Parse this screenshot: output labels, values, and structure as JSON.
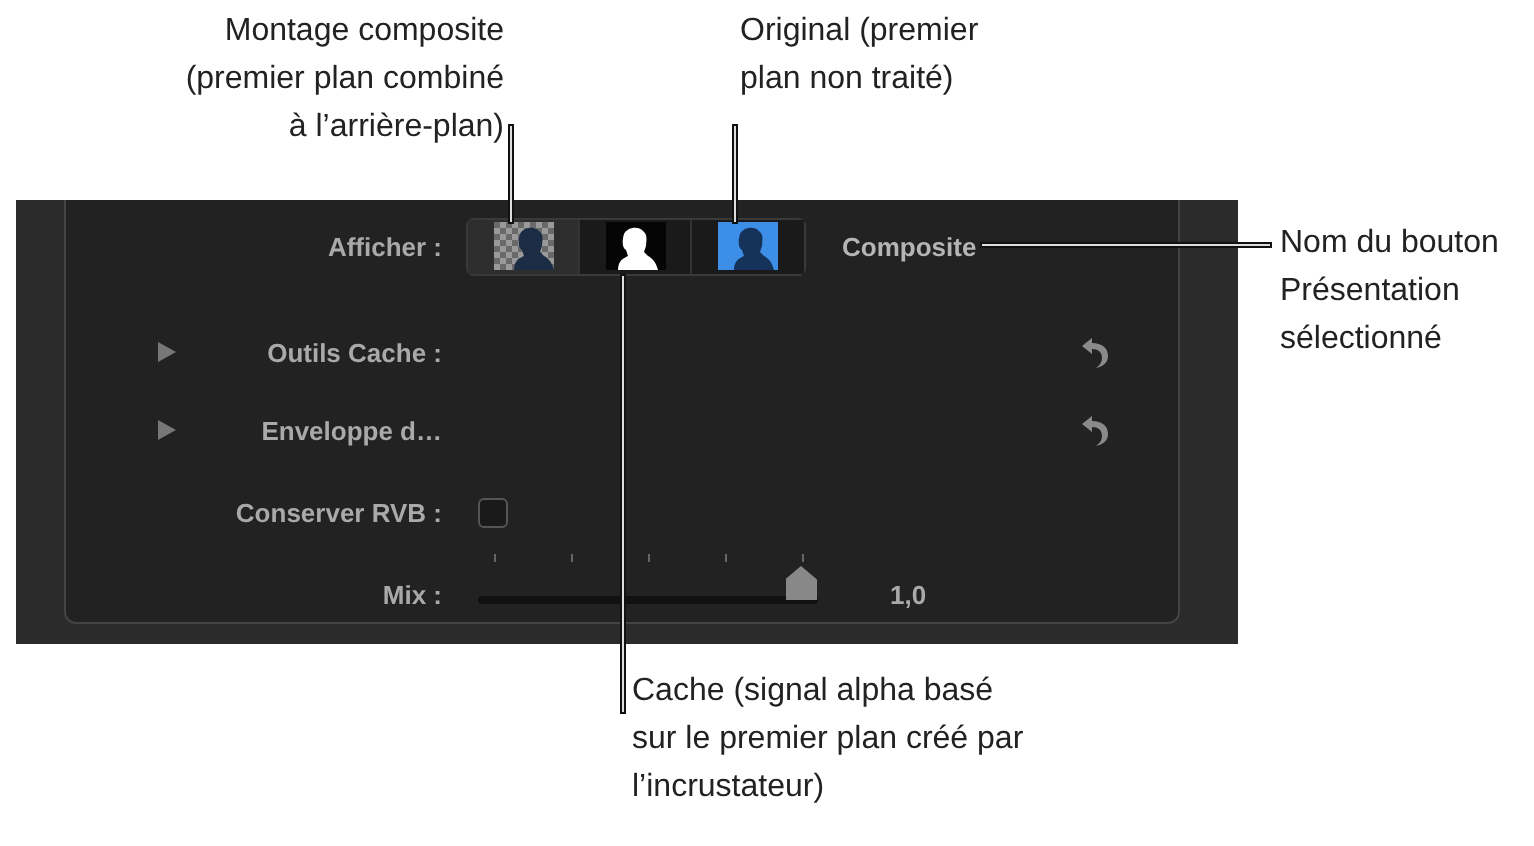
{
  "callouts": [
    {
      "lines": [
        "Montage composite",
        "(premier plan combiné",
        "à l’arrière-plan)"
      ]
    },
    {
      "lines": [
        "Original (premier",
        "plan non traité)"
      ]
    },
    {
      "lines": [
        "Nom du bouton",
        "Présentation",
        "sélectionné"
      ]
    },
    {
      "lines": [
        "Cache (signal alpha basé",
        "sur le premier plan créé par",
        "l’incrustateur)"
      ]
    }
  ],
  "panel": {
    "view": {
      "label": "Afficher :",
      "buttons": [
        {
          "kind": "composite",
          "selected": true
        },
        {
          "kind": "matte",
          "selected": false
        },
        {
          "kind": "original",
          "selected": false
        }
      ],
      "name": "Composite"
    },
    "rows": [
      {
        "kind": "disclosure",
        "label": "Outils Cache :",
        "expanded": false
      },
      {
        "kind": "disclosure",
        "label": "Enveloppe d…",
        "expanded": false
      },
      {
        "kind": "checkbox",
        "label": "Conserver RVB :",
        "checked": false
      },
      {
        "kind": "slider",
        "label": "Mix :",
        "level": 0.95,
        "reading": "1,0"
      }
    ]
  }
}
